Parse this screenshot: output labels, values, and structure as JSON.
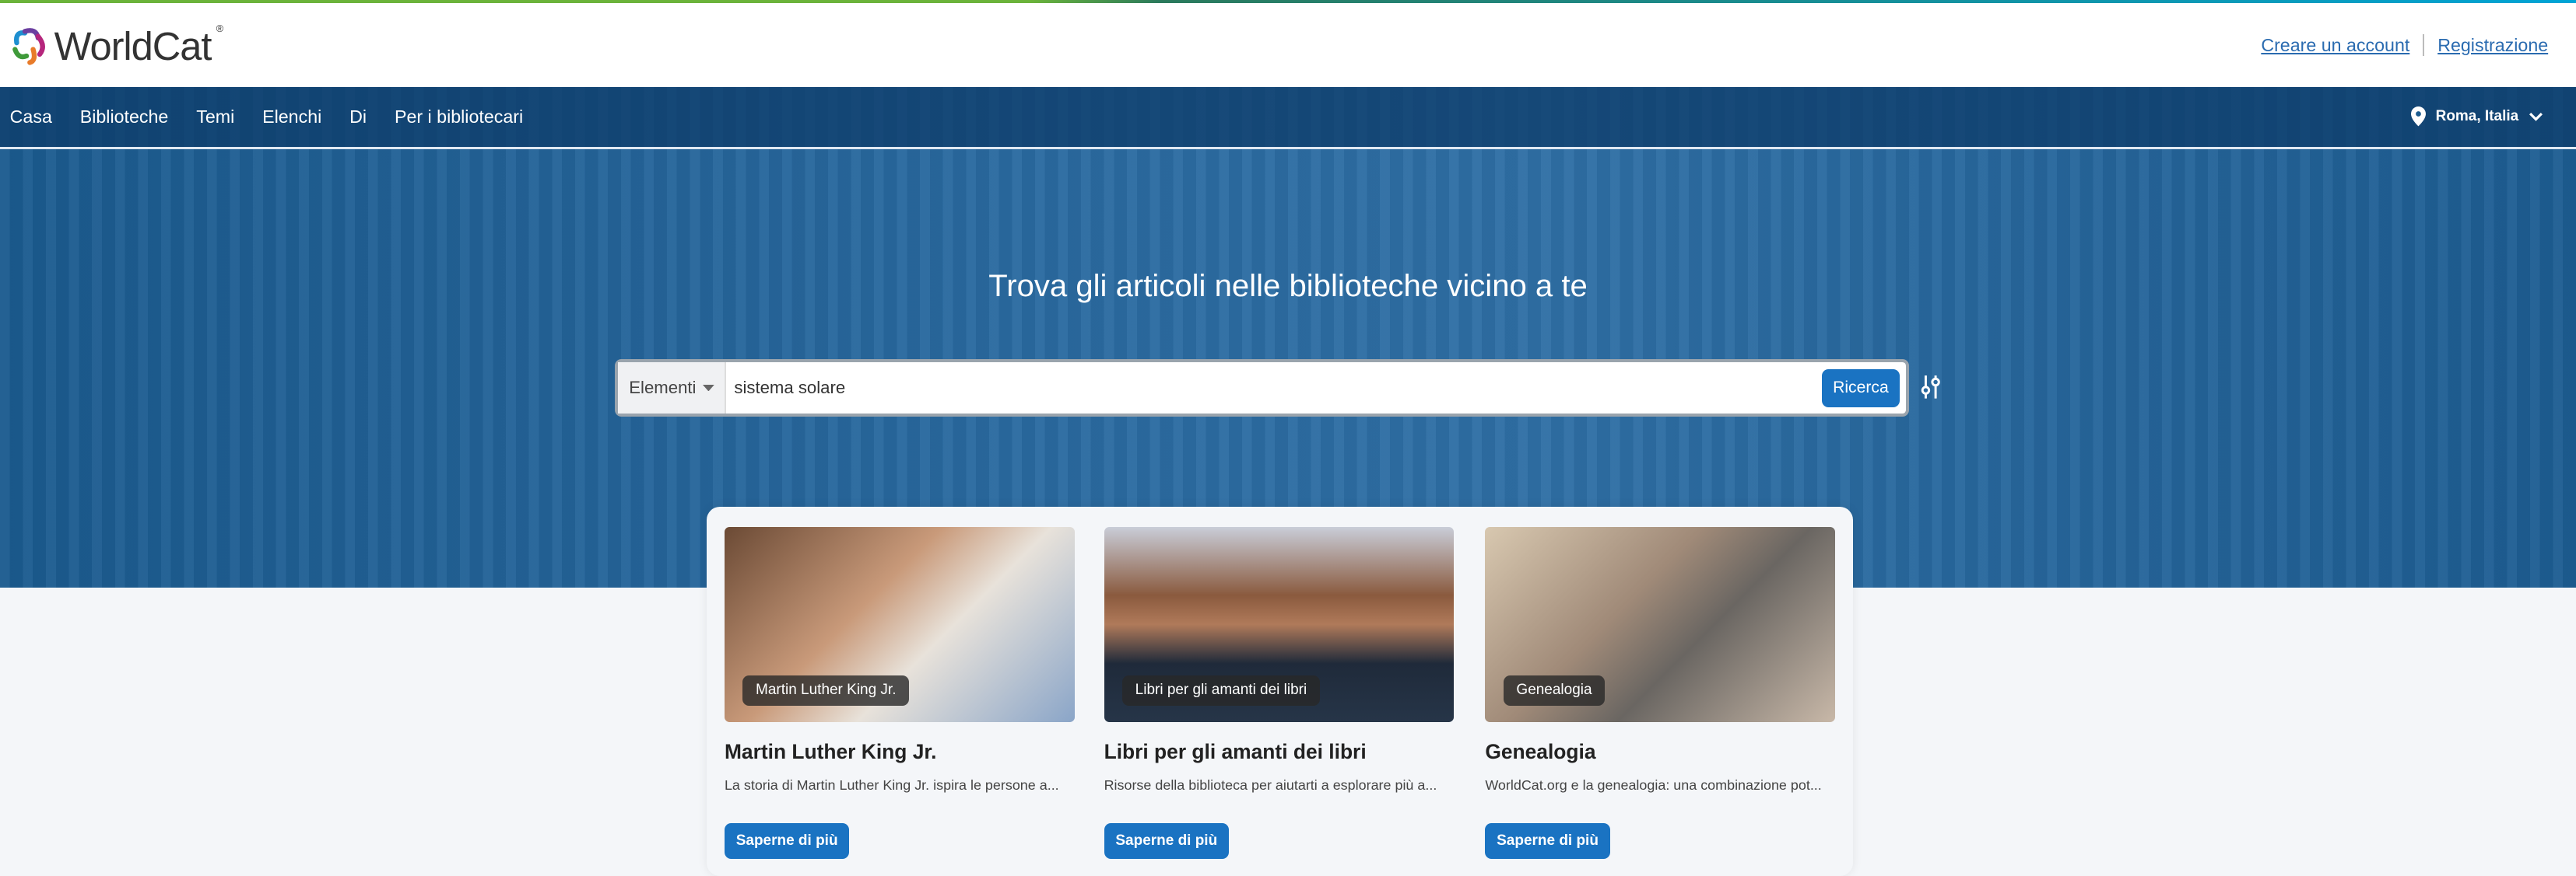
{
  "header": {
    "logo_text": "WorldCat",
    "create_account": "Creare un account",
    "register": "Registrazione"
  },
  "nav": {
    "items": [
      "Casa",
      "Biblioteche",
      "Temi",
      "Elenchi",
      "Di",
      "Per i bibliotecari"
    ],
    "location": "Roma, Italia"
  },
  "hero": {
    "title": "Trova gli articoli nelle biblioteche vicino a te"
  },
  "search": {
    "scope": "Elementi",
    "query": "sistema solare",
    "button": "Ricerca"
  },
  "colors": {
    "accent": "#1a73c2",
    "nav": "#0e3c69",
    "link": "#2a6bb0"
  },
  "cards": [
    {
      "tag": "Martin Luther King Jr.",
      "title": "Martin Luther King Jr.",
      "desc": "La storia di Martin Luther King Jr. ispira le persone a...",
      "button": "Saperne di più"
    },
    {
      "tag": "Libri per gli amanti dei libri",
      "title": "Libri per gli amanti dei libri",
      "desc": "Risorse della biblioteca per aiutarti a esplorare più a...",
      "button": "Saperne di più"
    },
    {
      "tag": "Genealogia",
      "title": "Genealogia",
      "desc": "WorldCat.org e la genealogia: una combinazione pot...",
      "button": "Saperne di più"
    }
  ]
}
